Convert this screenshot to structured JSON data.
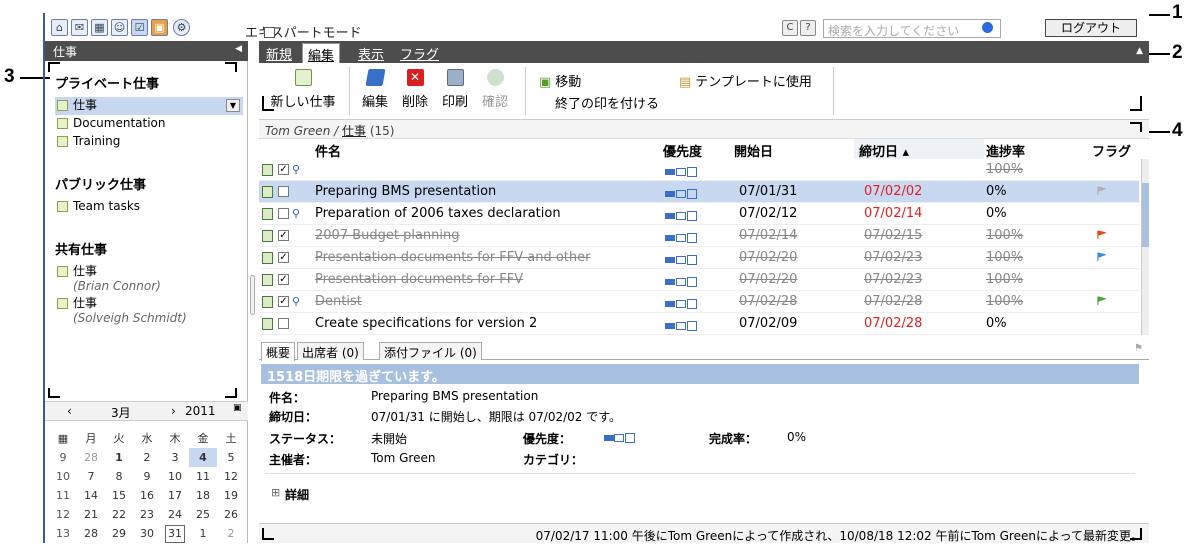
{
  "callouts": [
    "1",
    "2",
    "3",
    "4"
  ],
  "topbar": {
    "expert_mode": "エキスパートモード",
    "search_placeholder": "検索を入力してください",
    "logout": "ログアウト",
    "btn_c": "C",
    "btn_help": "?"
  },
  "sidebar": {
    "header": "仕事",
    "private_title": "プライベート仕事",
    "private_items": [
      "仕事",
      "Documentation",
      "Training"
    ],
    "public_title": "パブリック仕事",
    "public_items": [
      "Team tasks"
    ],
    "shared_title": "共有仕事",
    "shared_items": [
      {
        "label": "仕事",
        "owner": "(Brian Connor)"
      },
      {
        "label": "仕事",
        "owner": "(Solveigh Schmidt)"
      }
    ]
  },
  "calendar": {
    "prev": "‹",
    "month": "3月",
    "next": "›",
    "year": "2011",
    "weekdays": [
      "月",
      "火",
      "水",
      "木",
      "金",
      "土"
    ],
    "weeks": [
      [
        "9",
        "28",
        "1",
        "2",
        "3",
        "4",
        "5"
      ],
      [
        "10",
        "7",
        "8",
        "9",
        "10",
        "11",
        "12"
      ],
      [
        "11",
        "14",
        "15",
        "16",
        "17",
        "18",
        "19"
      ],
      [
        "12",
        "21",
        "22",
        "23",
        "24",
        "25",
        "26"
      ],
      [
        "13",
        "28",
        "29",
        "30",
        "31",
        "1",
        "2"
      ]
    ]
  },
  "tabs": [
    "新規",
    "編集",
    "表示",
    "フラグ"
  ],
  "toolbar": {
    "new_task": "新しい仕事",
    "edit": "編集",
    "delete": "削除",
    "print": "印刷",
    "confirm": "確認",
    "move": "移動",
    "mark_done": "終了の印を付ける",
    "use_template": "テンプレートに使用"
  },
  "breadcrumb": {
    "owner": "Tom Green /",
    "folder": "仕事",
    "count": "(15)"
  },
  "table": {
    "headers": {
      "subject": "件名",
      "priority": "優先度",
      "start": "開始日",
      "due": "締切日 ▴",
      "progress": "進捗率",
      "flag": "フラグ"
    },
    "rows": [
      {
        "subject": "",
        "start": "",
        "due": "",
        "progress": "100%",
        "done": true,
        "checked": true,
        "recurring": true,
        "flag": ""
      },
      {
        "subject": "Preparing BMS presentation",
        "start": "07/01/31",
        "due": "07/02/02",
        "progress": "0%",
        "done": false,
        "checked": false,
        "recurring": false,
        "flag": "#b0b0b0",
        "selected": true
      },
      {
        "subject": "Preparation of 2006 taxes declaration",
        "start": "07/02/12",
        "due": "07/02/14",
        "progress": "0%",
        "done": false,
        "checked": false,
        "recurring": true,
        "flag": ""
      },
      {
        "subject": "2007 Budget planning",
        "start": "07/02/14",
        "due": "07/02/15",
        "progress": "100%",
        "done": true,
        "checked": true,
        "recurring": false,
        "flag": "#e84a1a"
      },
      {
        "subject": "Presentation documents for FFV and other",
        "start": "07/02/20",
        "due": "07/02/23",
        "progress": "100%",
        "done": true,
        "checked": true,
        "recurring": false,
        "flag": "#3a8ee0"
      },
      {
        "subject": "Presentation documents for FFV",
        "start": "07/02/20",
        "due": "07/02/23",
        "progress": "100%",
        "done": true,
        "checked": true,
        "recurring": false,
        "flag": ""
      },
      {
        "subject": "Dentist",
        "start": "07/02/28",
        "due": "07/02/28",
        "progress": "100%",
        "done": true,
        "checked": true,
        "recurring": true,
        "flag": "#4aa830"
      },
      {
        "subject": "Create specifications for version 2",
        "start": "07/02/09",
        "due": "07/02/28",
        "progress": "0%",
        "done": false,
        "checked": false,
        "recurring": false,
        "flag": ""
      }
    ]
  },
  "detail": {
    "tabs": [
      "概要",
      "出席者 (0)",
      "添付ファイル (0)"
    ],
    "overdue": "1518日期限を過ぎています。",
    "subject_label": "件名：",
    "subject": "Preparing BMS presentation",
    "due_label": "締切日：",
    "due": "07/01/31 に開始し、期限は 07/02/02 です。",
    "status_label": "ステータス：",
    "status": "未開始",
    "priority_label": "優先度：",
    "completion_label": "完成率：",
    "completion": "0%",
    "organizer_label": "主催者：",
    "organizer": "Tom Green",
    "category_label": "カテゴリ：",
    "details_label": "詳細",
    "details_toggle": "⊞",
    "footer": "07/02/17 11:00 午後にTom Greenによって作成され、10/08/18 12:02 午前にTom Greenによって最新変更。"
  },
  "colors": {
    "header": "#4d4d4d",
    "selection": "#c8d8f0",
    "overdue_bar": "#a8c0e0",
    "due_red": "#e02020"
  }
}
